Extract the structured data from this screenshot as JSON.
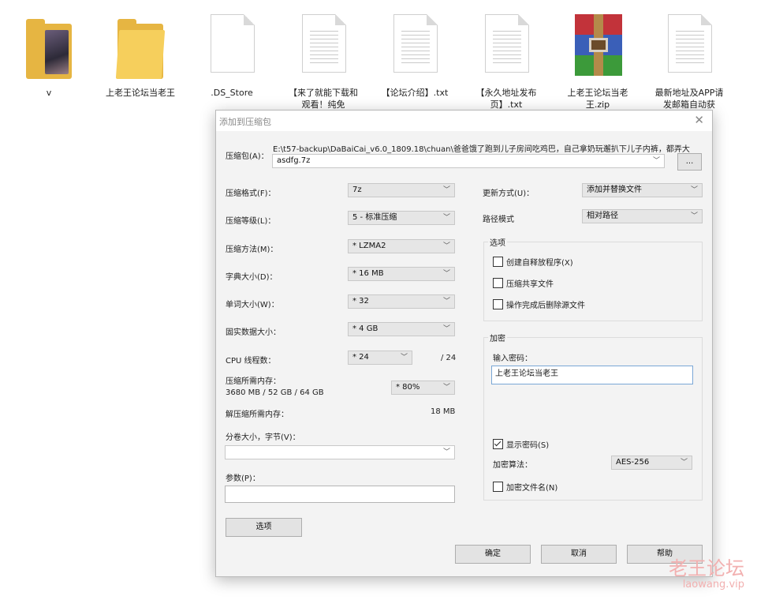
{
  "desktop": {
    "icons": [
      {
        "label": "v",
        "type": "photo-folder"
      },
      {
        "label": "上老王论坛当老王",
        "type": "folder"
      },
      {
        "label": ".DS_Store",
        "type": "file"
      },
      {
        "label": "【来了就能下载和观看！纯免",
        "type": "txt"
      },
      {
        "label": "【论坛介绍】.txt",
        "type": "txt"
      },
      {
        "label": "【永久地址发布页】.txt",
        "type": "txt"
      },
      {
        "label": "上老王论坛当老王.zip",
        "type": "winrar"
      },
      {
        "label": "最新地址及APP请发邮箱自动获",
        "type": "txt"
      }
    ]
  },
  "dialog": {
    "title": "添加到压缩包",
    "close_glyph": "✕",
    "archive": {
      "label": "压缩包(A)：",
      "path": "E:\\t57-backup\\DaBaiCai_v6.0_1809.18\\chuan\\爸爸饿了跑到儿子房间吃鸡巴，自己拿奶玩邂扒下儿子内裤，都弄大",
      "value": "asdfg.7z",
      "browse_label": "..."
    },
    "left": {
      "format": {
        "label": "压缩格式(F)：",
        "value": "7z"
      },
      "level": {
        "label": "压缩等级(L)：",
        "value": "5 - 标准压缩"
      },
      "method": {
        "label": "压缩方法(M)：",
        "value": "* LZMA2"
      },
      "dict": {
        "label": "字典大小(D)：",
        "value": "* 16 MB"
      },
      "word": {
        "label": "单词大小(W)：",
        "value": "* 32"
      },
      "solid": {
        "label": "固实数据大小：",
        "value": "* 4 GB"
      },
      "threads": {
        "label": "CPU 线程数：",
        "value": "* 24",
        "total": "/ 24"
      },
      "mem_compress": {
        "label": "压缩所需内存：",
        "detail": "3680 MB / 52 GB / 64 GB",
        "value": "* 80%"
      },
      "mem_decompress": {
        "label": "解压缩所需内存：",
        "value": "18 MB"
      },
      "split": {
        "label": "分卷大小，字节(V)：",
        "value": ""
      },
      "params": {
        "label": "参数(P)：",
        "value": ""
      },
      "options_button": "选项"
    },
    "right": {
      "update": {
        "label": "更新方式(U)：",
        "value": "添加并替换文件"
      },
      "path_mode": {
        "label": "路径模式",
        "value": "相对路径"
      },
      "options_group": {
        "title": "选项",
        "sfx": {
          "label": "创建自释放程序(X)",
          "checked": false
        },
        "shared": {
          "label": "压缩共享文件",
          "checked": false
        },
        "delete_after": {
          "label": "操作完成后删除源文件",
          "checked": false
        }
      },
      "encryption": {
        "title": "加密",
        "password_label": "输入密码：",
        "password": "上老王论坛当老王",
        "show_password": {
          "label": "显示密码(S)",
          "checked": true
        },
        "method_label": "加密算法：",
        "method_value": "AES-256",
        "encrypt_names": {
          "label": "加密文件名(N)",
          "checked": false
        }
      }
    },
    "buttons": {
      "ok": "确定",
      "cancel": "取消",
      "help": "帮助"
    }
  },
  "watermark": {
    "cn": "老王论坛",
    "url": "laowang.vip"
  },
  "colors": {
    "folder": "#f6cf5c",
    "dialog_bg": "#f3f3f3",
    "field_focus_border": "#7aa7d6",
    "watermark": "#f2b0b0"
  }
}
